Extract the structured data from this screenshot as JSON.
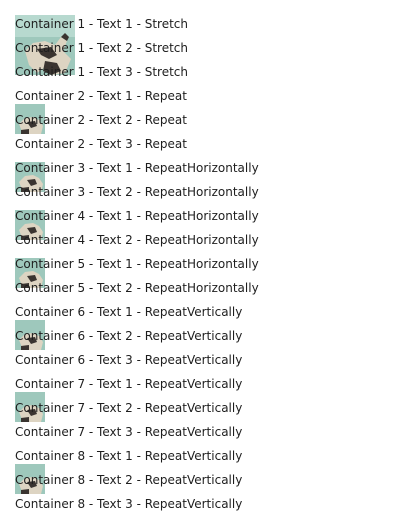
{
  "window": {
    "background": "#ffffff",
    "text_color": "#1e1e1e"
  },
  "background_image": {
    "icon": "statue-photo",
    "sky_color": "#9ec8bc",
    "stone_color": "#ddd4c2",
    "shadow_color": "#3a3430"
  },
  "containers": [
    {
      "name": "container-1",
      "mode": "Stretch",
      "texts": [
        "Container 1 - Text 1 - Stretch",
        "Container 1 - Text 2 - Stretch",
        "Container 1 - Text 3 - Stretch"
      ]
    },
    {
      "name": "container-2",
      "mode": "Repeat",
      "texts": [
        "Container 2 - Text 1 - Repeat",
        "Container 2 - Text 2 - Repeat",
        "Container 2 - Text 3 - Repeat"
      ]
    },
    {
      "name": "container-3",
      "mode": "RepeatHorizontally",
      "texts": [
        "Container 3 - Text 1 - RepeatHorizontally",
        "Container 3 - Text 2 - RepeatHorizontally"
      ]
    },
    {
      "name": "container-4",
      "mode": "RepeatHorizontally",
      "texts": [
        "Container 4 - Text 1 - RepeatHorizontally",
        "Container 4 - Text 2 - RepeatHorizontally"
      ]
    },
    {
      "name": "container-5",
      "mode": "RepeatHorizontally",
      "texts": [
        "Container 5 - Text 1 - RepeatHorizontally",
        "Container 5 - Text 2 - RepeatHorizontally"
      ]
    },
    {
      "name": "container-6",
      "mode": "RepeatVertically",
      "texts": [
        "Container 6 - Text 1 - RepeatVertically",
        "Container 6 - Text 2 - RepeatVertically",
        "Container 6 - Text 3 - RepeatVertically"
      ]
    },
    {
      "name": "container-7",
      "mode": "RepeatVertically",
      "texts": [
        "Container 7 - Text 1 - RepeatVertically",
        "Container 7 - Text 2 - RepeatVertically",
        "Container 7 - Text 3 - RepeatVertically"
      ]
    },
    {
      "name": "container-8",
      "mode": "RepeatVertically",
      "texts": [
        "Container 8 - Text 1 - RepeatVertically",
        "Container 8 - Text 2 - RepeatVertically",
        "Container 8 - Text 3 - RepeatVertically"
      ]
    }
  ]
}
